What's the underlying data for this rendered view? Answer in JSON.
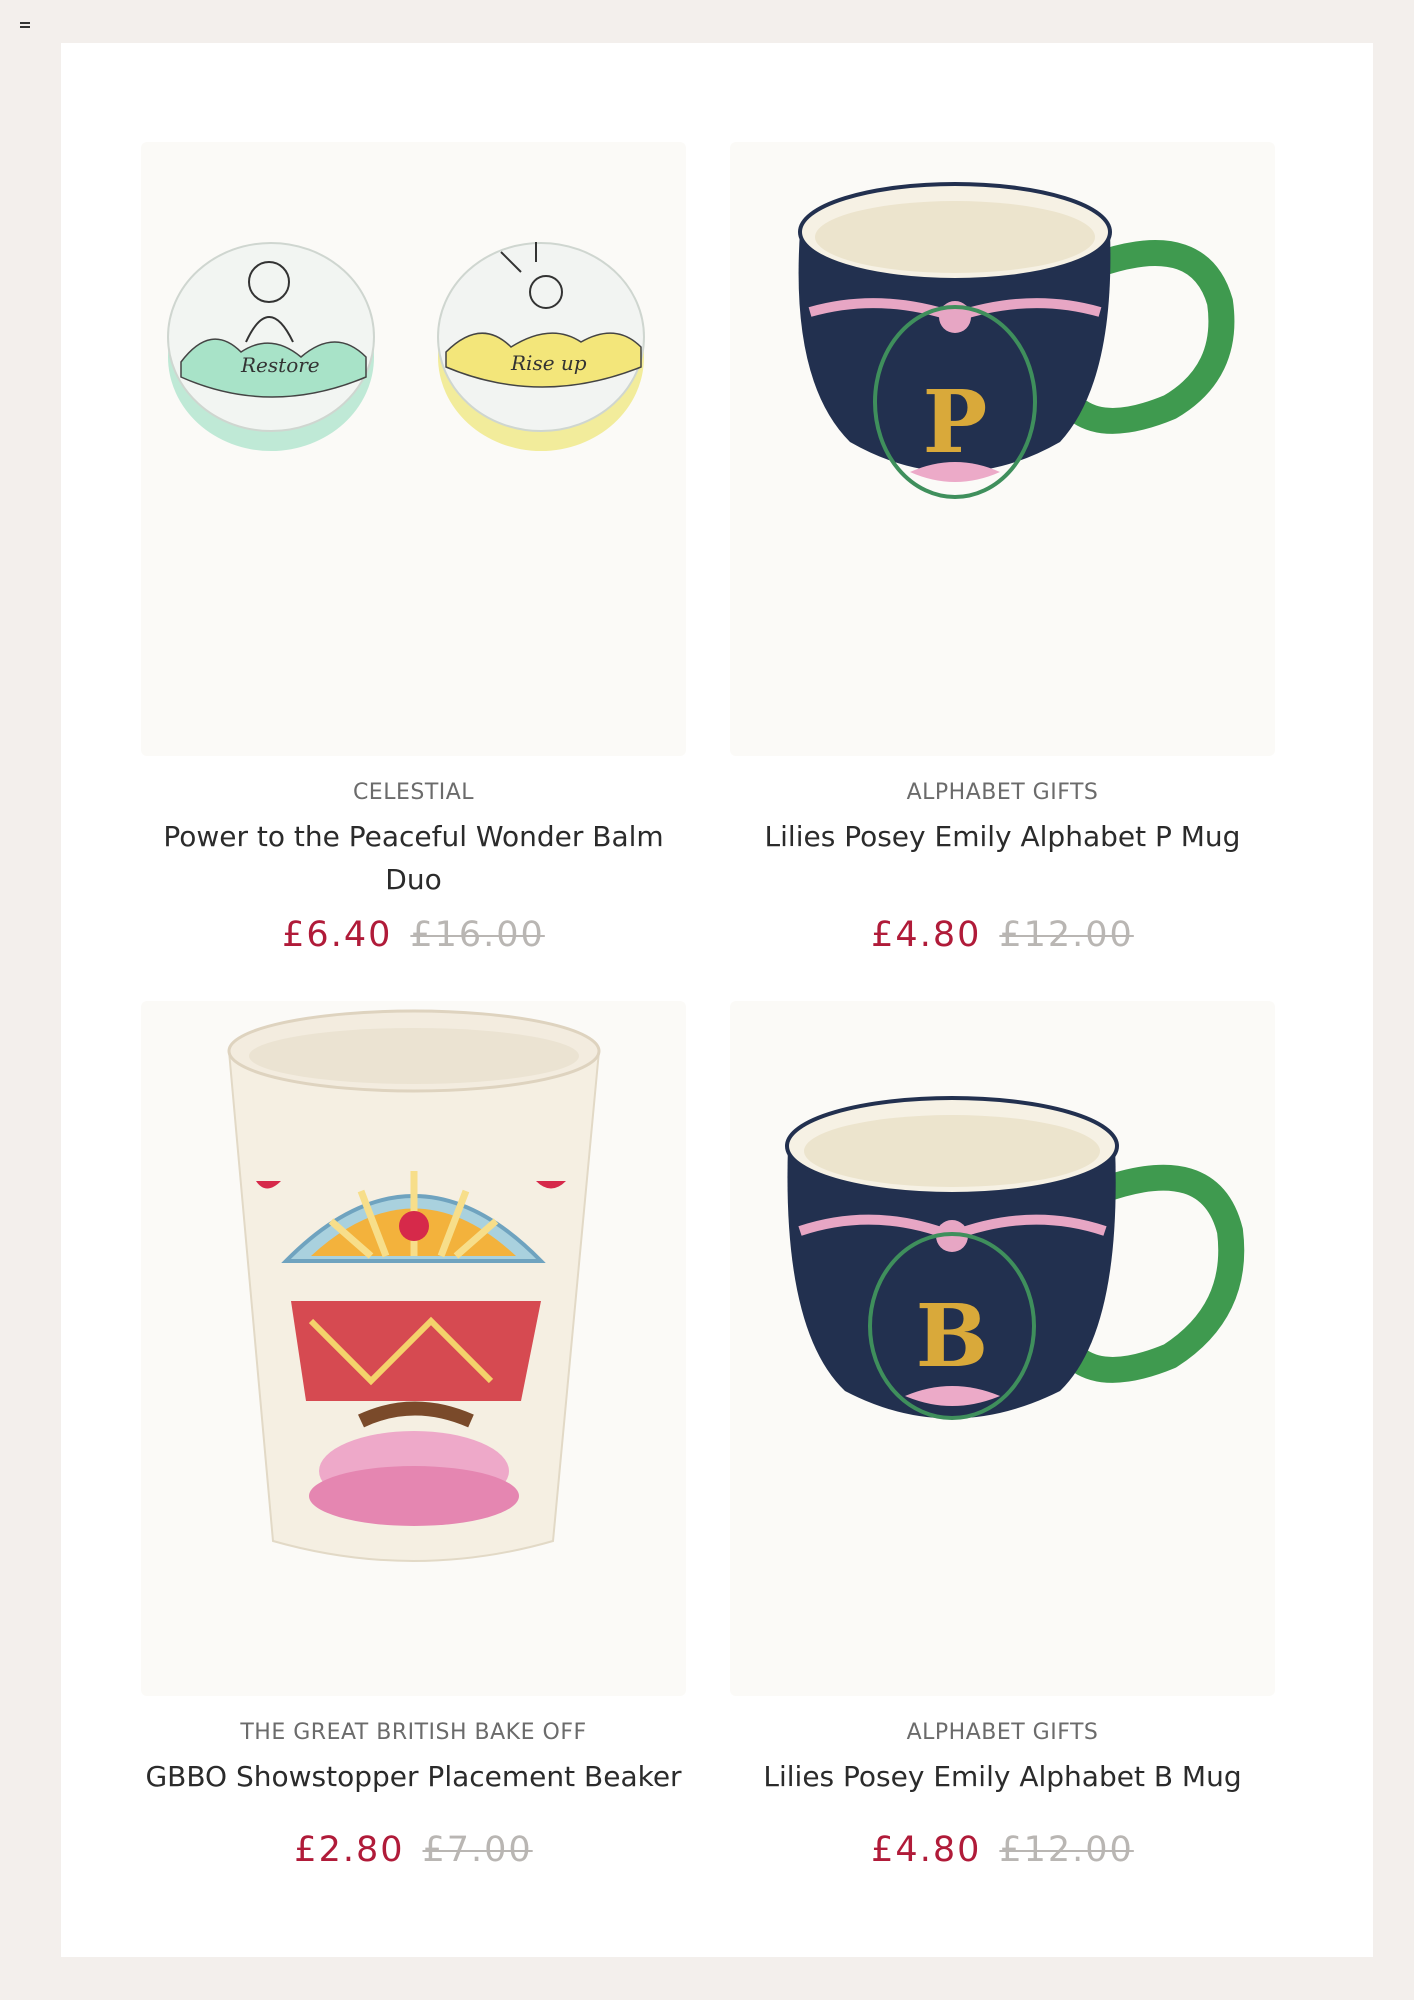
{
  "nav": {
    "menu_icon": "hamburger-menu-icon"
  },
  "colors": {
    "sale_price": "#b01b39",
    "was_price": "#b9b6b3",
    "page_bg": "#f3efec"
  },
  "products": [
    {
      "brand": "CELESTIAL",
      "title": "Power to the Peaceful Wonder Balm Duo",
      "price_now": "£6.40",
      "price_was": "£16.00",
      "tin_left_text": "Restore",
      "tin_right_text": "Rise up"
    },
    {
      "brand": "ALPHABET GIFTS",
      "title": "Lilies Posey Emily Alphabet P Mug",
      "price_now": "£4.80",
      "price_was": "£12.00",
      "mug_letter": "P"
    },
    {
      "brand": "THE GREAT BRITISH BAKE OFF",
      "title": "GBBO Showstopper Placement Beaker",
      "price_now": "£2.80",
      "price_was": "£7.00"
    },
    {
      "brand": "ALPHABET GIFTS",
      "title": "Lilies Posey Emily Alphabet B Mug",
      "price_now": "£4.80",
      "price_was": "£12.00",
      "mug_letter": "B"
    }
  ]
}
